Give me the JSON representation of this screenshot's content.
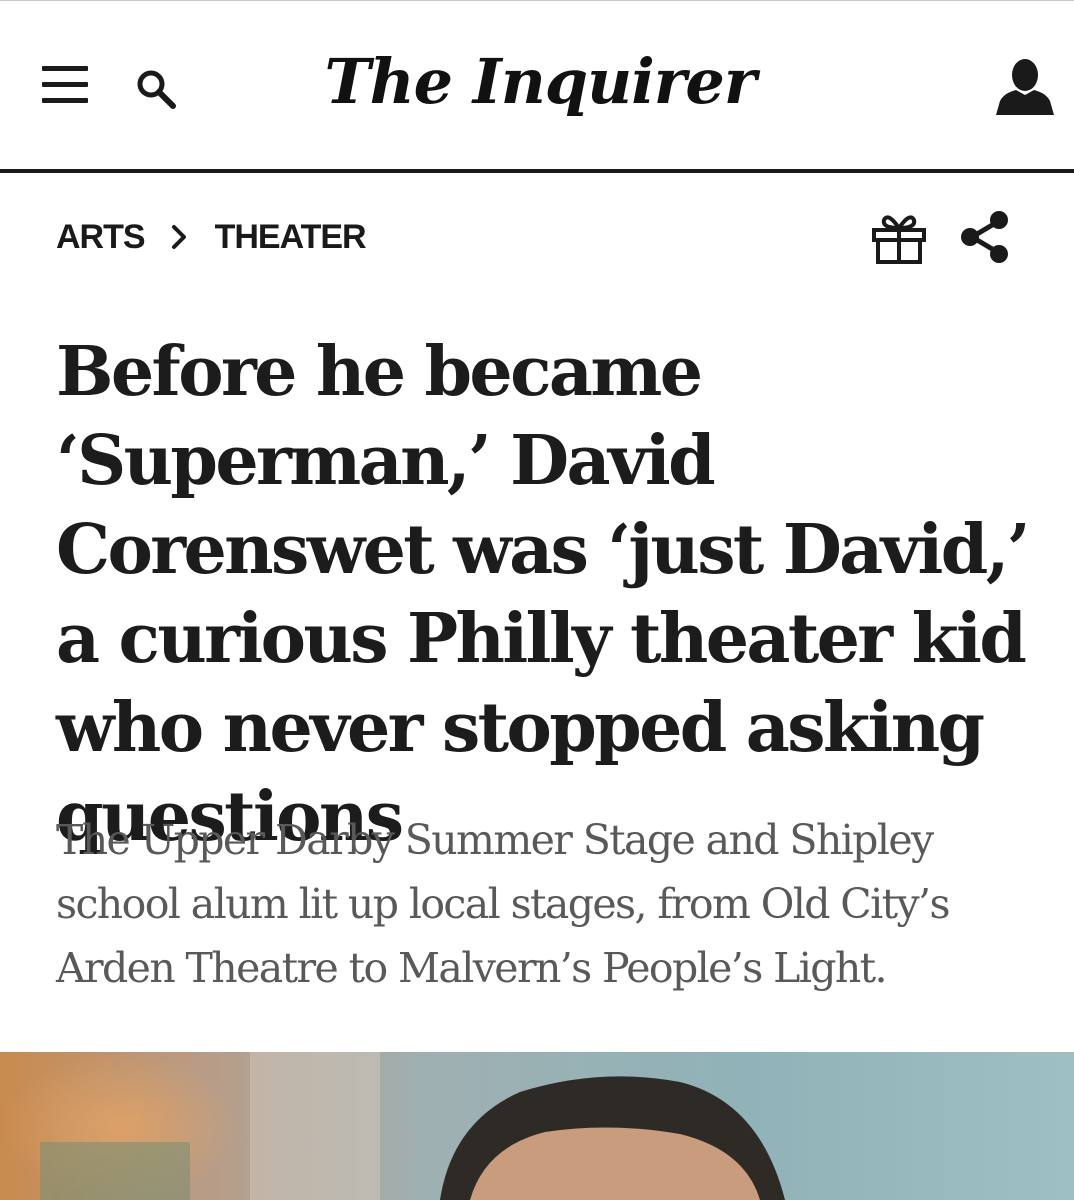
{
  "masthead": {
    "logo_text": "The Inquirer",
    "menu_icon": "hamburger-menu-icon",
    "search_icon": "search-icon",
    "account_icon": "user-account-icon"
  },
  "breadcrumb": {
    "items": [
      {
        "label": "ARTS"
      },
      {
        "label": "THEATER"
      }
    ],
    "separator_icon": "chevron-right-icon"
  },
  "article_actions": {
    "gift_icon": "gift-icon",
    "share_icon": "share-icon"
  },
  "article": {
    "headline": "Before he became ‘Superman,’ David Corenswet was ‘just David,’ a curious Philly theater kid who never stopped asking questions",
    "dek": "The Upper Darby Summer Stage and Shipley school alum lit up local stages, from Old City’s Arden Theatre to Malvern’s People’s Light."
  },
  "colors": {
    "text": "#1c1c1c",
    "dek_text": "#595959",
    "rule": "#1a1a1a"
  }
}
